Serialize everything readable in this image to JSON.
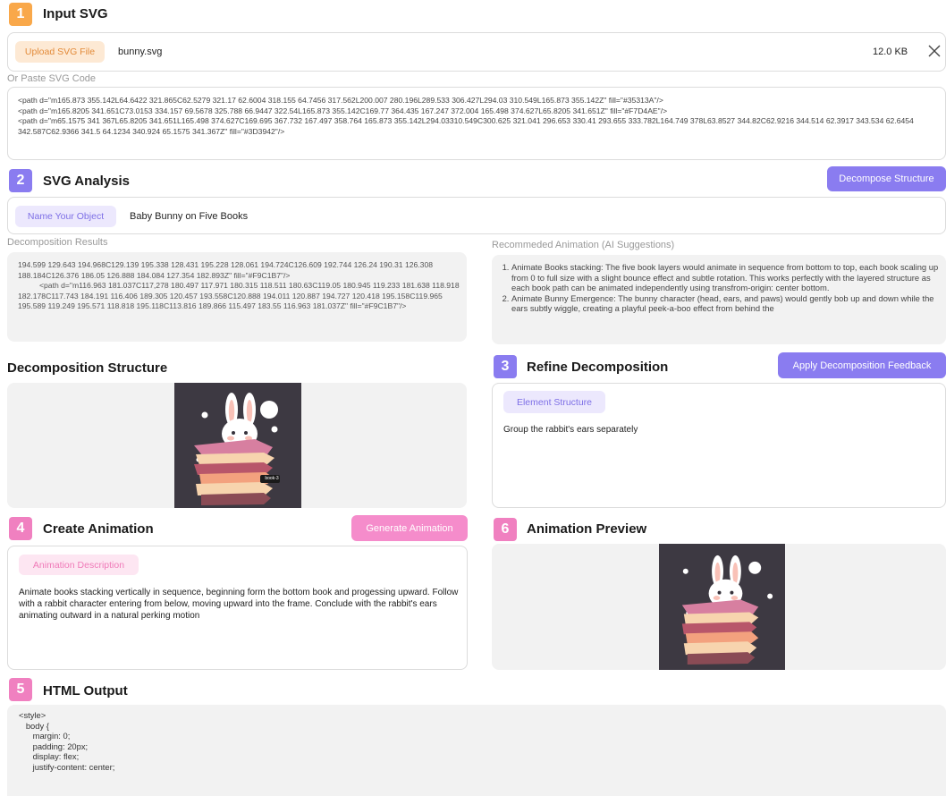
{
  "colors": {
    "orange": "#F9A84A",
    "purple": "#8A7CF0",
    "pink": "#F080C0",
    "pink_button": "#F58CCB",
    "upload_chip_bg": "#FDE9D4",
    "upload_chip_text": "#E38B3A",
    "purple_chip_bg": "#ECE8FD",
    "purple_chip_text": "#7D6FE6",
    "pink_chip_bg": "#FDE6F2",
    "pink_chip_text": "#F07AB8",
    "preview_bg": "#3D3942"
  },
  "input_svg": {
    "step": "1",
    "title": "Input SVG",
    "upload_label": "Upload SVG File",
    "file_name": "bunny.svg",
    "file_size": "12.0 KB",
    "close_icon": "close-icon",
    "paste_label": "Or Paste SVG Code",
    "code_lines": [
      "<path d=\"m165.873 355.142L64.6422 321.865C62.5279 321.17 62.6004 318.155 64.7456 317.562L200.007 280.196L289.533 306.427L294.03 310.549L165.873 355.142Z\" fill=\"#35313A\"/>",
      "<path d=\"m165.8205 341.651C73.0153 334.157 69.5678 325.788 66.9447 322.54L165.873 355.142C169.77 364.435 167.247 372.004 165.498 374.627L65.8205 341.651Z\" fill=\"#F7D4AE\"/>",
      "<path d=\"m65.1575 341 367L65.8205 341.651L165.498 374.627C169.695 367.732 167.497 358.764 165.873 355.142L294.03310.549C300.625 321.041 296.653 330.41 293.655 333.782L164.749 378L63.8527 344.82C62.9216 344.514 62.3917 343.534 62.6454 342.587C62.9366 341.5 64.1234 340.924 65.1575 341.367Z\" fill=\"#3D3942\"/>"
    ]
  },
  "svg_analysis": {
    "step": "2",
    "title": "SVG Analysis",
    "decompose_button": "Decompose Structure",
    "name_chip": "Name Your Object",
    "object_name": "Baby Bunny on Five Books",
    "results_label": "Decomposition Results",
    "results_text": "194.599 129.643 194.968C129.139 195.338 128.431 195.228 128.061 194.724C126.609 192.744 126.24 190.31 126.308 188.184C126.376 186.05 126.888 184.084 127.354 182.893Z\" fill=\"#F9C1B7\"/>",
    "results_text_2": "<path d=\"m116.963 181.037C117,278 180.497 117.971 180.315 118.511 180.63C119.05 180.945 119.233 181.638 118.918 182.178C117.743 184.191 116.406 189.305 120.457 193.558C120.888 194.011 120.887 194.727 120.418 195.158C119.965 195.589 119.249 195.571 118.818 195.118C113.816 189.866 115.497 183.55 116.963 181.037Z\" fill=\"#F9C1B7\"/>",
    "suggest_label": "Recommeded Animation (AI Suggestions)",
    "suggestions": [
      "Animate Books stacking: The five book layers would animate in sequence from bottom to top, each book scaling up from  0 to full size with a slight bounce effect and subtle rotation. This works perfectly with the layered structure as each book path can be animated independently using transfrom-origin: center bottom.",
      "Animate Bunny Emergence: The bunny character (head, ears, and paws) would gently bob up and down while the ears subtly wiggle, creating a playful peek-a-boo effect from behind the"
    ]
  },
  "decomposition_structure": {
    "title": "Decomposition Structure",
    "book_tag": "book-3"
  },
  "refine": {
    "step": "3",
    "title": "Refine Decomposition",
    "apply_button": "Apply Decomposition Feedback",
    "chip": "Element Structure",
    "feedback_text": "Group the rabbit's ears separately"
  },
  "create_animation": {
    "step": "4",
    "title": "Create Animation",
    "generate_button": "Generate Animation",
    "chip": "Animation Description",
    "description": "Animate books stacking vertically in sequence, beginning form the bottom book and progessing upward. Follow with a rabbit character entering from below, moving upward into the frame. Conclude with the rabbit's ears animating outward in a natural perking motion"
  },
  "html_output": {
    "step": "5",
    "title": "HTML Output",
    "code_lines": [
      "<style>",
      "   body {",
      "      margin: 0;",
      "      padding: 20px;",
      "      display: flex;",
      "      justify-content: center;"
    ]
  },
  "preview": {
    "step": "6",
    "title": "Animation Preview"
  }
}
